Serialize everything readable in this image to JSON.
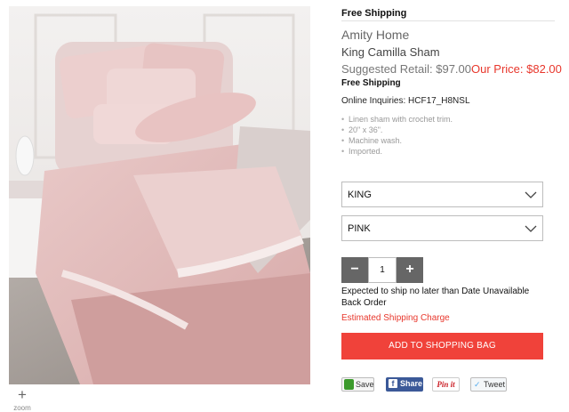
{
  "top_bar": {
    "free_shipping": "Free Shipping"
  },
  "product": {
    "brand": "Amity Home",
    "name": "King Camilla Sham",
    "suggested_retail": "Suggested Retail: $97.00",
    "our_price": "Our Price: $82.00",
    "free_shipping": "Free Shipping",
    "online_inquiries": "Online Inquiries: HCF17_H8NSL",
    "features": [
      "Linen sham with crochet trim.",
      "20\" x 36\".",
      "Machine wash.",
      "Imported."
    ]
  },
  "image": {
    "zoom_icon": "plus-icon",
    "zoom_label": "zoom"
  },
  "options": {
    "size": {
      "selected": "KING"
    },
    "color": {
      "selected": "PINK"
    }
  },
  "quantity": {
    "minus": "−",
    "value": "1",
    "plus": "+"
  },
  "shipping": {
    "expected": "Expected to ship no later than Date Unavailable",
    "status": "Back Order",
    "estimate_link": "Estimated Shipping Charge"
  },
  "cart": {
    "add_label": "ADD TO SHOPPING BAG"
  },
  "social": {
    "save": "Save",
    "share": "Share",
    "share_icon": "f",
    "pin": "Pin it",
    "tweet": "Tweet"
  },
  "colors": {
    "accent_red": "#e8372c",
    "button_red": "#f0423a",
    "stepper_gray": "#666666",
    "facebook": "#3b5998"
  }
}
